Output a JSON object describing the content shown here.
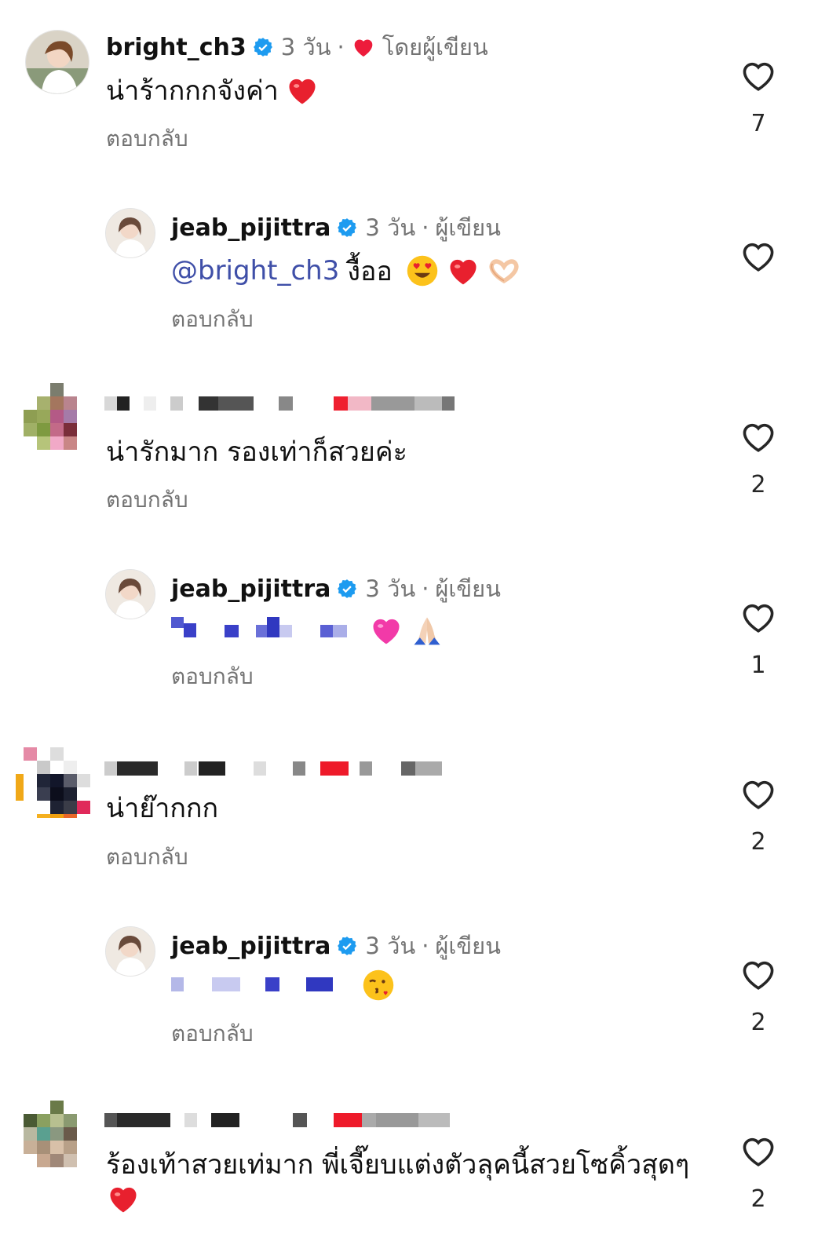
{
  "comments": [
    {
      "username": "bright_ch3",
      "time": "3 วัน",
      "author_like_label": "โดยผู้เขียน",
      "text": "น่าร้ากกกจังค่า",
      "reply_label": "ตอบกลับ",
      "likes": "7"
    },
    {
      "username": "jeab_pijittra",
      "time": "3 วัน",
      "author_label": "ผู้เขียน",
      "mention": "@bright_ch3",
      "text": "งื้ออ",
      "reply_label": "ตอบกลับ",
      "likes": ""
    },
    {
      "text": "น่ารักมาก รองเท่าก็สวยค่ะ",
      "reply_label": "ตอบกลับ",
      "likes": "2"
    },
    {
      "username": "jeab_pijittra",
      "time": "3 วัน",
      "author_label": "ผู้เขียน",
      "reply_label": "ตอบกลับ",
      "likes": "1"
    },
    {
      "text": "น่าย๊ากกก",
      "reply_label": "ตอบกลับ",
      "likes": "2"
    },
    {
      "username": "jeab_pijittra",
      "time": "3 วัน",
      "author_label": "ผู้เขียน",
      "reply_label": "ตอบกลับ",
      "likes": "2"
    },
    {
      "text": "ร้องเท้าสวยเท่มาก พี่เจี๊ยบแต่งตัวลุคนี้สวยโซคิ้วสุดๆ",
      "likes": "2"
    }
  ],
  "icons": {
    "verified": "verified-badge-icon",
    "like": "heart-outline-icon",
    "author_like": "red-heart-icon"
  },
  "colors": {
    "verified": "#1d9bf0",
    "heart_red": "#ed1c3b",
    "meta_gray": "#737373",
    "mention": "#3f4fa8"
  }
}
